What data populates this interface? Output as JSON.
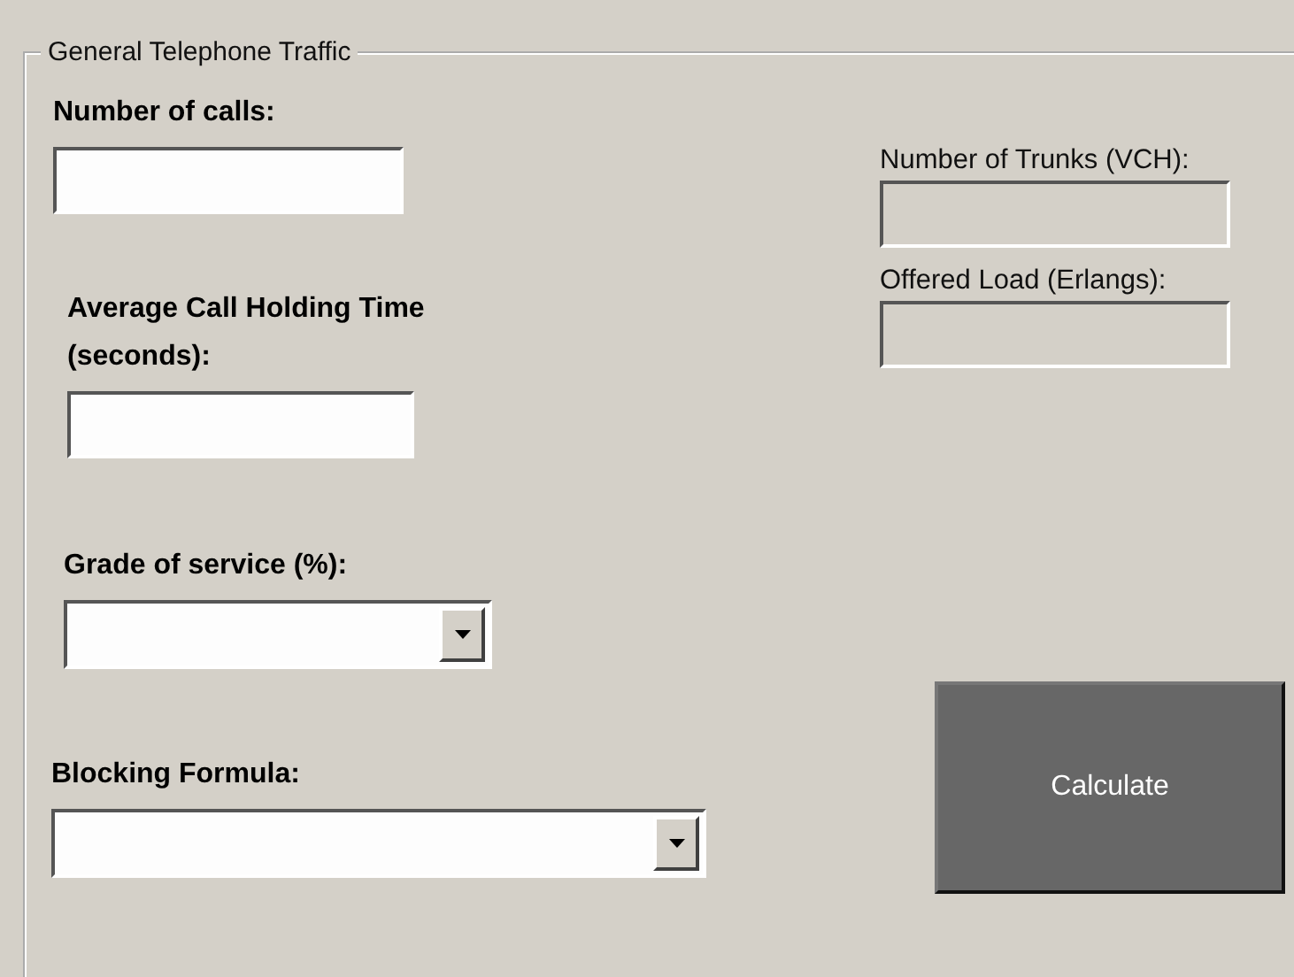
{
  "group": {
    "title": "General Telephone Traffic"
  },
  "inputs": [
    {
      "label": "Number of calls:",
      "kind": "text",
      "disabled": false
    },
    {
      "label": "Average Call Holding Time (seconds):",
      "kind": "text",
      "disabled": false
    },
    {
      "label": "Grade of service (%):",
      "kind": "select",
      "disabled": false
    },
    {
      "label": "Blocking Formula:",
      "kind": "select",
      "disabled": false
    }
  ],
  "outputs": [
    {
      "label": "Number of Trunks (VCH):",
      "disabled": true
    },
    {
      "label": "Offered Load (Erlangs):",
      "disabled": true
    }
  ],
  "button": {
    "label": "Calculate"
  }
}
